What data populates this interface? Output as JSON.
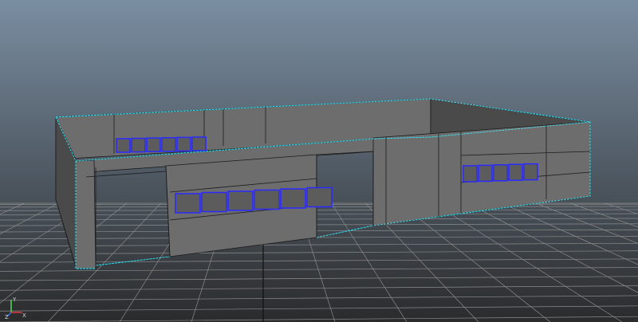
{
  "viewport": {
    "background_top": "#7a8ea2",
    "background_bottom": "#2a2b2c",
    "grid_color": "#8c8c8c",
    "grid_axis_color": "#111111"
  },
  "model": {
    "fill_light": "#6d6d6d",
    "fill_dark": "#4a4a4a",
    "edge_color": "#1b1b1b",
    "selected_edge_color": "#35dcec",
    "window_frame_color": "#2a2aff"
  },
  "axis_indicator": {
    "x_label": "X",
    "y_label": "Y",
    "z_label": "Z",
    "x_color": "#e23a3a",
    "y_color": "#4fe04f",
    "z_color": "#3a6be2"
  }
}
